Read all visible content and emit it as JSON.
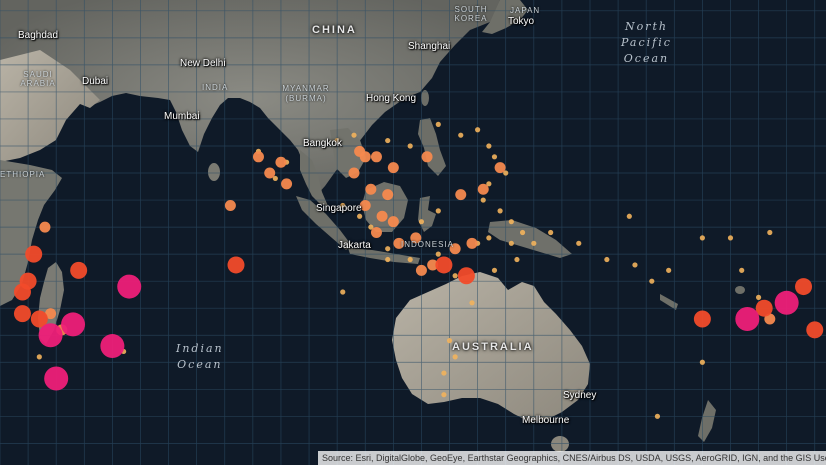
{
  "map": {
    "cities": [
      {
        "name": "Baghdad"
      },
      {
        "name": "Dubai"
      },
      {
        "name": "New Delhi"
      },
      {
        "name": "Mumbai"
      },
      {
        "name": "Bangkok"
      },
      {
        "name": "Singapore"
      },
      {
        "name": "Jakarta"
      },
      {
        "name": "Hong Kong"
      },
      {
        "name": "Shanghai"
      },
      {
        "name": "Tokyo"
      },
      {
        "name": "Sydney"
      },
      {
        "name": "Melbourne"
      }
    ],
    "countries": {
      "china": "CHINA",
      "india": "INDIA",
      "australia": "AUSTRALIA",
      "indonesia": "INDONESIA",
      "myanmar": "MYANMAR (BURMA)",
      "south_korea": "SOUTH KOREA",
      "japan": "JAPAN",
      "saudi_arabia": "SAUDI ARABIA",
      "ethiopia": "ETHIOPIA"
    },
    "oceans": {
      "indian": [
        "Indian",
        "Ocean"
      ],
      "north_pacific": [
        "North",
        "Pacific",
        "Ocean"
      ]
    },
    "marker_colors": {
      "small": "#f2b35c",
      "medium": "#f5894e",
      "large": "#f24b2a",
      "xlarge": "#ee1f78"
    },
    "markers": [
      {
        "lon": 44,
        "lat": -20,
        "size": "xlarge"
      },
      {
        "lon": 48,
        "lat": -18,
        "size": "xlarge"
      },
      {
        "lon": 55,
        "lat": -22,
        "size": "xlarge"
      },
      {
        "lon": 58,
        "lat": -11,
        "size": "xlarge"
      },
      {
        "lon": 45,
        "lat": -28,
        "size": "xlarge"
      },
      {
        "lon": 40,
        "lat": -10,
        "size": "large"
      },
      {
        "lon": 39,
        "lat": -16,
        "size": "large"
      },
      {
        "lon": 42,
        "lat": -17,
        "size": "large"
      },
      {
        "lon": 41,
        "lat": -5,
        "size": "large"
      },
      {
        "lon": 39,
        "lat": -12,
        "size": "large"
      },
      {
        "lon": 49,
        "lat": -8,
        "size": "large"
      },
      {
        "lon": 77,
        "lat": -7,
        "size": "large"
      },
      {
        "lon": 44,
        "lat": -16,
        "size": "medium"
      },
      {
        "lon": 46,
        "lat": -19,
        "size": "medium"
      },
      {
        "lon": 43,
        "lat": 0,
        "size": "medium"
      },
      {
        "lon": 76,
        "lat": 4,
        "size": "medium"
      },
      {
        "lon": 81,
        "lat": 13,
        "size": "medium"
      },
      {
        "lon": 83,
        "lat": 10,
        "size": "medium"
      },
      {
        "lon": 85,
        "lat": 12,
        "size": "medium"
      },
      {
        "lon": 86,
        "lat": 8,
        "size": "medium"
      },
      {
        "lon": 98,
        "lat": 10,
        "size": "medium"
      },
      {
        "lon": 99,
        "lat": 14,
        "size": "medium"
      },
      {
        "lon": 100,
        "lat": 13,
        "size": "medium"
      },
      {
        "lon": 102,
        "lat": 13,
        "size": "medium"
      },
      {
        "lon": 105,
        "lat": 11,
        "size": "medium"
      },
      {
        "lon": 111,
        "lat": 13,
        "size": "medium"
      },
      {
        "lon": 101,
        "lat": 7,
        "size": "medium"
      },
      {
        "lon": 104,
        "lat": 6,
        "size": "medium"
      },
      {
        "lon": 100,
        "lat": 4,
        "size": "medium"
      },
      {
        "lon": 103,
        "lat": 2,
        "size": "medium"
      },
      {
        "lon": 105,
        "lat": 1,
        "size": "medium"
      },
      {
        "lon": 102,
        "lat": -1,
        "size": "medium"
      },
      {
        "lon": 106,
        "lat": -3,
        "size": "medium"
      },
      {
        "lon": 109,
        "lat": -2,
        "size": "medium"
      },
      {
        "lon": 110,
        "lat": -8,
        "size": "medium"
      },
      {
        "lon": 116,
        "lat": -4,
        "size": "medium"
      },
      {
        "lon": 119,
        "lat": -3,
        "size": "medium"
      },
      {
        "lon": 117,
        "lat": 6,
        "size": "medium"
      },
      {
        "lon": 121,
        "lat": 7,
        "size": "medium"
      },
      {
        "lon": 124,
        "lat": 11,
        "size": "medium"
      },
      {
        "lon": 112,
        "lat": -7,
        "size": "medium"
      },
      {
        "lon": 114,
        "lat": -7,
        "size": "large"
      },
      {
        "lon": 118,
        "lat": -9,
        "size": "large"
      },
      {
        "lon": 168,
        "lat": -17,
        "size": "xlarge"
      },
      {
        "lon": 175,
        "lat": -14,
        "size": "xlarge"
      },
      {
        "lon": 160,
        "lat": -17,
        "size": "large"
      },
      {
        "lon": 171,
        "lat": -15,
        "size": "large"
      },
      {
        "lon": 178,
        "lat": -11,
        "size": "large"
      },
      {
        "lon": 180,
        "lat": -19,
        "size": "large"
      },
      {
        "lon": 172,
        "lat": -17,
        "size": "medium"
      },
      {
        "lon": 81,
        "lat": 14,
        "size": "small"
      },
      {
        "lon": 84,
        "lat": 9,
        "size": "small"
      },
      {
        "lon": 86,
        "lat": 12,
        "size": "small"
      },
      {
        "lon": 95,
        "lat": 16,
        "size": "small"
      },
      {
        "lon": 98,
        "lat": 17,
        "size": "small"
      },
      {
        "lon": 104,
        "lat": 16,
        "size": "small"
      },
      {
        "lon": 108,
        "lat": 15,
        "size": "small"
      },
      {
        "lon": 113,
        "lat": 19,
        "size": "small"
      },
      {
        "lon": 117,
        "lat": 17,
        "size": "small"
      },
      {
        "lon": 120,
        "lat": 18,
        "size": "small"
      },
      {
        "lon": 122,
        "lat": 15,
        "size": "small"
      },
      {
        "lon": 123,
        "lat": 13,
        "size": "small"
      },
      {
        "lon": 125,
        "lat": 10,
        "size": "small"
      },
      {
        "lon": 122,
        "lat": 8,
        "size": "small"
      },
      {
        "lon": 121,
        "lat": 5,
        "size": "small"
      },
      {
        "lon": 124,
        "lat": 3,
        "size": "small"
      },
      {
        "lon": 126,
        "lat": 1,
        "size": "small"
      },
      {
        "lon": 128,
        "lat": -1,
        "size": "small"
      },
      {
        "lon": 122,
        "lat": -2,
        "size": "small"
      },
      {
        "lon": 120,
        "lat": -3,
        "size": "small"
      },
      {
        "lon": 126,
        "lat": -3,
        "size": "small"
      },
      {
        "lon": 130,
        "lat": -3,
        "size": "small"
      },
      {
        "lon": 127,
        "lat": -6,
        "size": "small"
      },
      {
        "lon": 123,
        "lat": -8,
        "size": "small"
      },
      {
        "lon": 119,
        "lat": -9,
        "size": "small"
      },
      {
        "lon": 116,
        "lat": -9,
        "size": "small"
      },
      {
        "lon": 113,
        "lat": -5,
        "size": "small"
      },
      {
        "lon": 108,
        "lat": -6,
        "size": "small"
      },
      {
        "lon": 104,
        "lat": -6,
        "size": "small"
      },
      {
        "lon": 104,
        "lat": -4,
        "size": "small"
      },
      {
        "lon": 99,
        "lat": 2,
        "size": "small"
      },
      {
        "lon": 96,
        "lat": 4,
        "size": "small"
      },
      {
        "lon": 101,
        "lat": 0,
        "size": "small"
      },
      {
        "lon": 110,
        "lat": 1,
        "size": "small"
      },
      {
        "lon": 113,
        "lat": 3,
        "size": "small"
      },
      {
        "lon": 96,
        "lat": -12,
        "size": "small"
      },
      {
        "lon": 119,
        "lat": -14,
        "size": "small"
      },
      {
        "lon": 115,
        "lat": -21,
        "size": "small"
      },
      {
        "lon": 116,
        "lat": -24,
        "size": "small"
      },
      {
        "lon": 114,
        "lat": -27,
        "size": "small"
      },
      {
        "lon": 114,
        "lat": -31,
        "size": "small"
      },
      {
        "lon": 133,
        "lat": -1,
        "size": "small"
      },
      {
        "lon": 138,
        "lat": -3,
        "size": "small"
      },
      {
        "lon": 143,
        "lat": -6,
        "size": "small"
      },
      {
        "lon": 148,
        "lat": -7,
        "size": "small"
      },
      {
        "lon": 151,
        "lat": -10,
        "size": "small"
      },
      {
        "lon": 154,
        "lat": -8,
        "size": "small"
      },
      {
        "lon": 160,
        "lat": -25,
        "size": "small"
      },
      {
        "lon": 152,
        "lat": -35,
        "size": "small"
      },
      {
        "lon": 160,
        "lat": -2,
        "size": "small"
      },
      {
        "lon": 165,
        "lat": -2,
        "size": "small"
      },
      {
        "lon": 172,
        "lat": -1,
        "size": "small"
      },
      {
        "lon": 167,
        "lat": -8,
        "size": "small"
      },
      {
        "lon": 147,
        "lat": 2,
        "size": "small"
      },
      {
        "lon": 57,
        "lat": -23,
        "size": "small"
      },
      {
        "lon": 42,
        "lat": -24,
        "size": "small"
      },
      {
        "lon": 170,
        "lat": -13,
        "size": "small"
      }
    ],
    "attribution": "Source: Esri, DigitalGlobe, GeoEye, Earthstar Geographics, CNES/Airbus DS, USDA, USGS, AeroGRID, IGN, and the GIS User Community"
  }
}
